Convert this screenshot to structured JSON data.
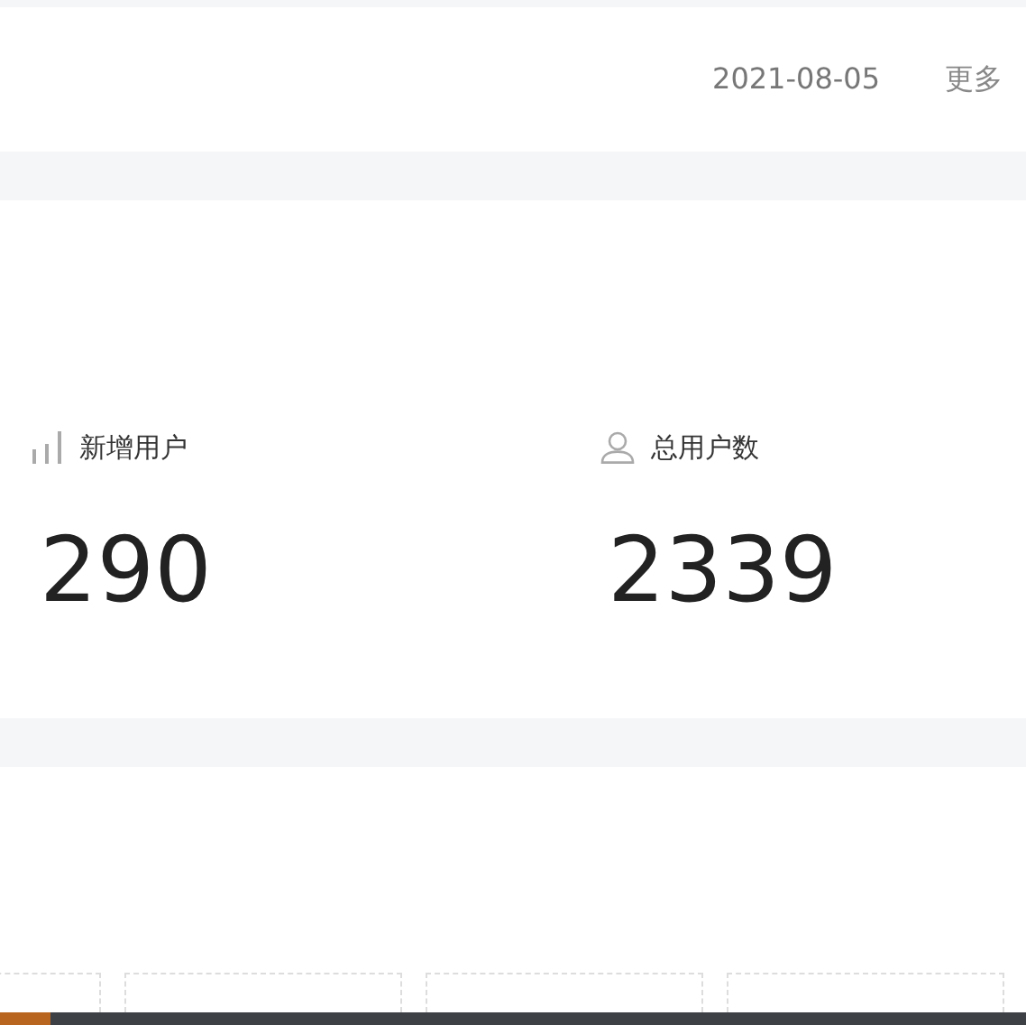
{
  "header": {
    "date": "2021-08-05",
    "more": "更多"
  },
  "stats": [
    {
      "kind": "bars",
      "label": "新增用户",
      "value": "290"
    },
    {
      "kind": "person",
      "label": "总用户数",
      "value": "2339"
    }
  ]
}
